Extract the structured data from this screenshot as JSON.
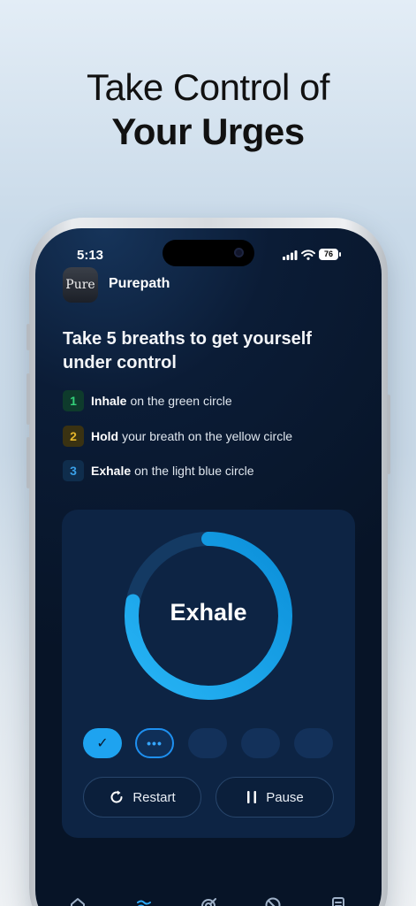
{
  "headline": {
    "line1": "Take Control of",
    "line2": "Your Urges"
  },
  "status_bar": {
    "time": "5:13",
    "battery": "76"
  },
  "app": {
    "logo_text": "Pure",
    "name": "Purepath"
  },
  "exercise": {
    "title": "Take 5 breaths to get yourself under control",
    "steps": [
      {
        "number": "1",
        "bold": "Inhale",
        "rest": "on the green circle",
        "color": "#33d17a"
      },
      {
        "number": "2",
        "bold": "Hold",
        "rest": "your breath on the yellow circle",
        "color": "#e6b62b"
      },
      {
        "number": "3",
        "bold": "Exhale",
        "rest": "on the light blue circle",
        "color": "#3aa0e8"
      }
    ],
    "phase_label": "Exhale",
    "phase_progress": 0.78,
    "breaths_total": 5,
    "breaths_completed": 1,
    "current_breath": 2,
    "restart_label": "Restart",
    "pause_label": "Pause"
  },
  "colors": {
    "accent": "#1ea3f0",
    "ring": "#1ea3f0",
    "ring_track": "#143a63",
    "background": "#0b1c36"
  },
  "tabbar": {
    "icons": [
      "home-icon",
      "breathe-icon",
      "goals-icon",
      "block-icon",
      "journal-icon"
    ]
  }
}
